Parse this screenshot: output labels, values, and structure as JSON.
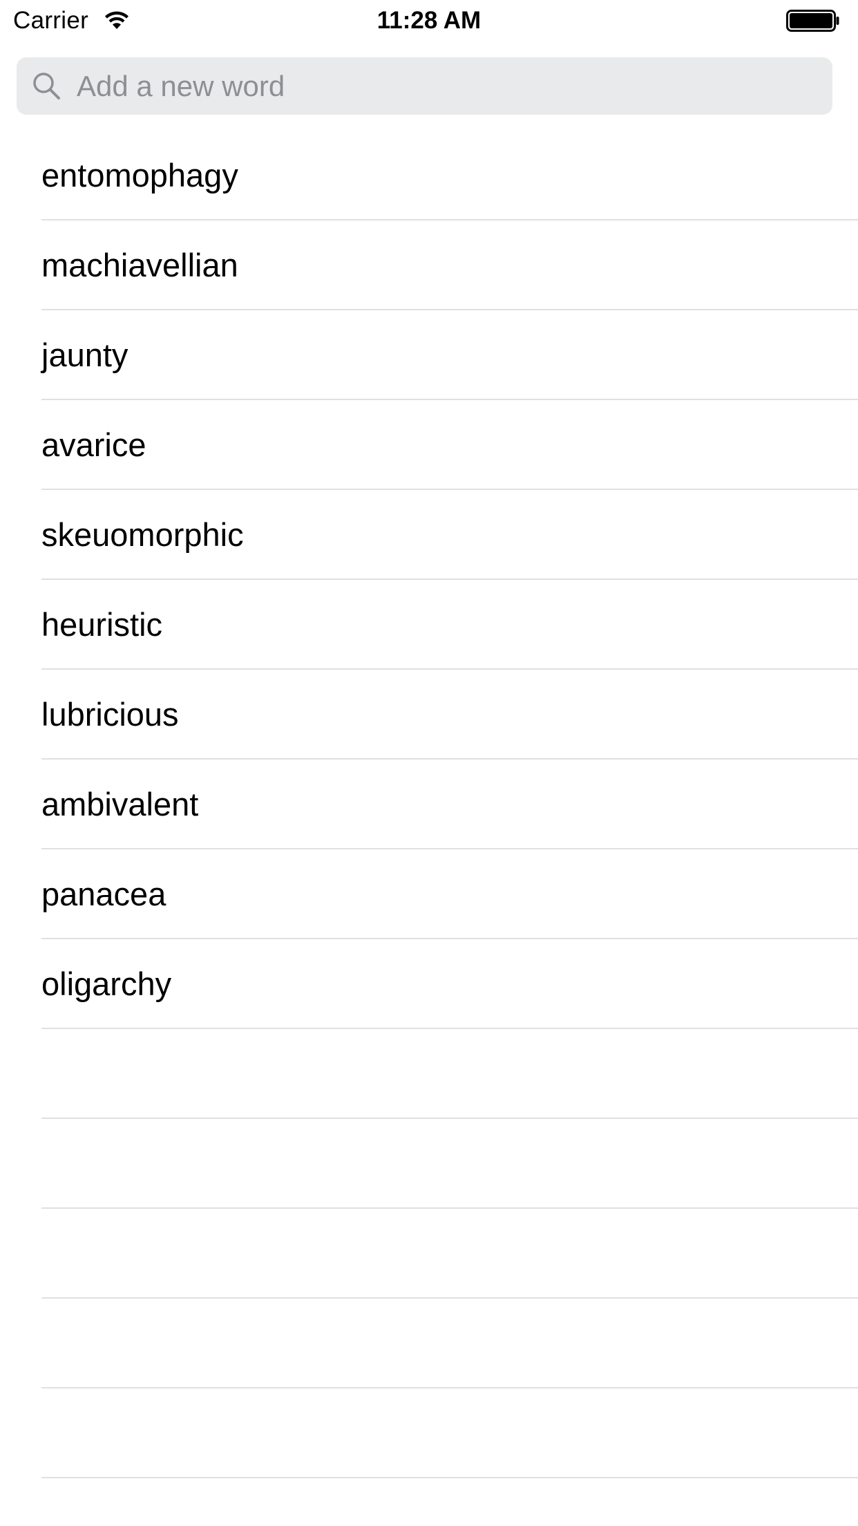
{
  "status_bar": {
    "carrier": "Carrier",
    "time": "11:28 AM",
    "wifi_icon": "wifi-icon",
    "battery_icon": "battery-full-icon"
  },
  "search": {
    "placeholder": "Add a new word",
    "value": "",
    "icon": "search-icon",
    "background_color": "#e9eaeb",
    "placeholder_color": "#8e8e93"
  },
  "words": [
    "entomophagy",
    "machiavellian",
    "jaunty",
    "avarice",
    "skeuomorphic",
    "heuristic",
    "lubricious",
    "ambivalent",
    "panacea",
    "oligarchy"
  ],
  "separator_color": "#e0e0e3"
}
